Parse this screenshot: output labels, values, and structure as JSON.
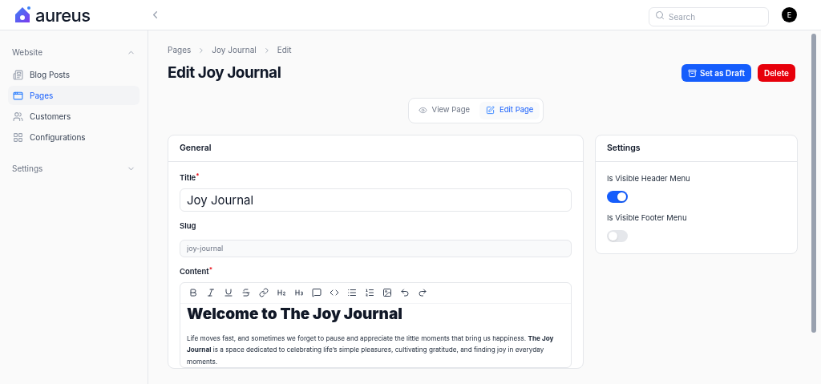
{
  "brand": {
    "name": "aureus"
  },
  "search": {
    "placeholder": "Search"
  },
  "user": {
    "initial": "E"
  },
  "sidebar": {
    "groups": [
      {
        "label": "Website",
        "expanded": true,
        "items": [
          {
            "label": "Blog Posts",
            "kind": "posts",
            "selected": false
          },
          {
            "label": "Pages",
            "kind": "pages",
            "selected": true
          },
          {
            "label": "Customers",
            "kind": "customers",
            "selected": false
          },
          {
            "label": "Configurations",
            "kind": "config",
            "selected": false
          }
        ]
      },
      {
        "label": "Settings",
        "expanded": false
      }
    ]
  },
  "breadcrumbs": [
    "Pages",
    "Joy Journal",
    "Edit"
  ],
  "page_title": "Edit Joy Journal",
  "actions": [
    {
      "label": "Set as Draft",
      "kind": "draft"
    },
    {
      "label": "Delete",
      "kind": "delete"
    }
  ],
  "view_tabs": [
    {
      "label": "View Page",
      "kind": "view",
      "selected": false
    },
    {
      "label": "Edit Page",
      "kind": "edit",
      "selected": true
    }
  ],
  "general": {
    "title": "General",
    "fields": [
      {
        "label": "Title",
        "required_mark": "*",
        "value": "Joy Journal",
        "kind": "large",
        "disabled": false
      },
      {
        "label": "Slug",
        "value": "joy-journal",
        "kind": "small",
        "disabled": true
      }
    ],
    "content": {
      "label": "Content",
      "required_mark": "*",
      "toolbar": [
        {
          "kind": "bold"
        },
        {
          "kind": "italic"
        },
        {
          "kind": "underline"
        },
        {
          "kind": "strike"
        },
        {
          "kind": "link"
        },
        {
          "kind": "h2"
        },
        {
          "kind": "h3"
        },
        {
          "kind": "quote"
        },
        {
          "kind": "code"
        },
        {
          "kind": "bullets"
        },
        {
          "kind": "numbers"
        },
        {
          "kind": "image"
        },
        {
          "kind": "undo"
        },
        {
          "kind": "redo"
        }
      ],
      "heading": "Welcome to The Joy Journal",
      "paragraph": "Life moves fast, and sometimes we forget to pause and appreciate the little moments that bring us happiness. **The Joy Journal** is a space dedicated to celebrating life’s simple pleasures, cultivating gratitude, and finding joy in everyday moments."
    }
  },
  "settings": {
    "title": "Settings",
    "toggles": [
      {
        "label": "Is Visible Header Menu",
        "on": true
      },
      {
        "label": "Is Visible Footer Menu",
        "on": false
      }
    ]
  }
}
